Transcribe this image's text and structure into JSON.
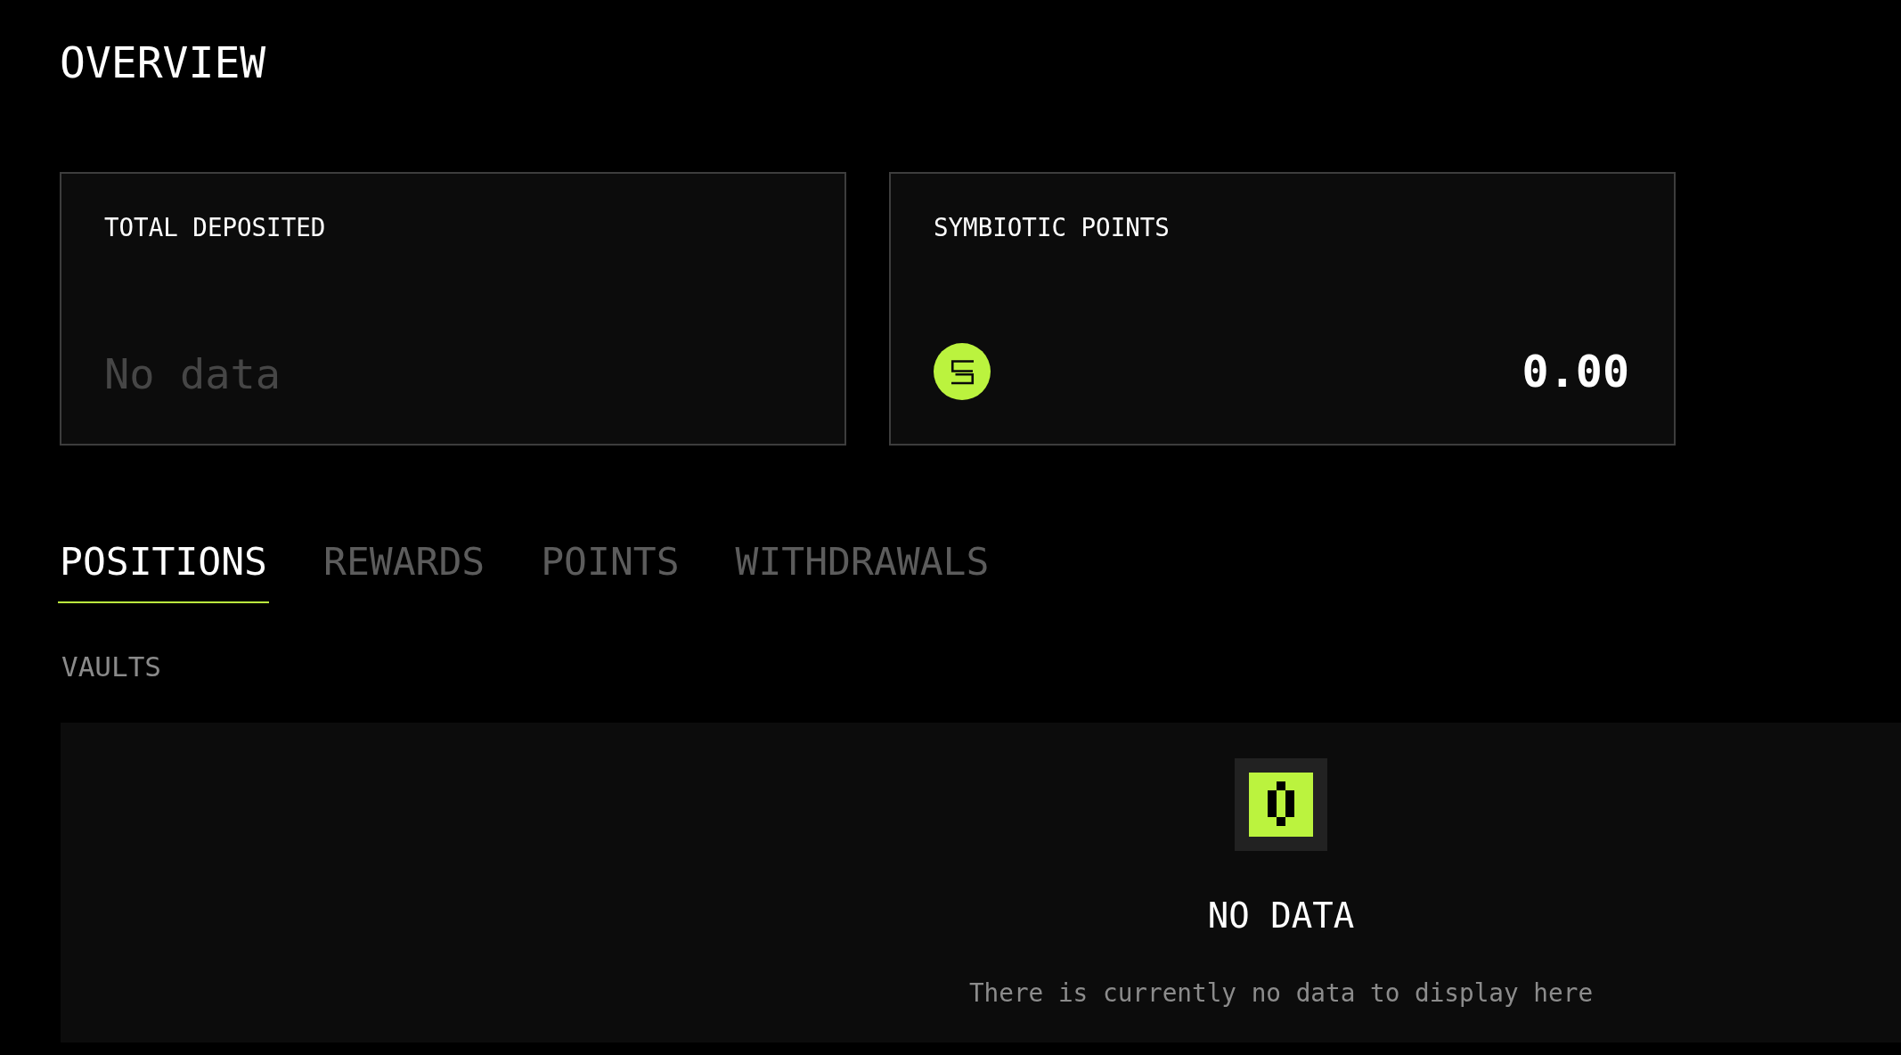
{
  "page": {
    "title": "OVERVIEW"
  },
  "stats": [
    {
      "kind": "empty",
      "label": "TOTAL DEPOSITED",
      "value": "No data"
    },
    {
      "kind": "points",
      "label": "SYMBIOTIC POINTS",
      "value": "0.00"
    }
  ],
  "tabs": [
    {
      "label": "POSITIONS",
      "selected": true
    },
    {
      "label": "REWARDS",
      "selected": false
    },
    {
      "label": "POINTS",
      "selected": false
    },
    {
      "label": "WITHDRAWALS",
      "selected": false
    }
  ],
  "section": {
    "title": "VAULTS",
    "empty_state": {
      "title": "NO DATA",
      "message": "There is currently no data to display here"
    }
  }
}
